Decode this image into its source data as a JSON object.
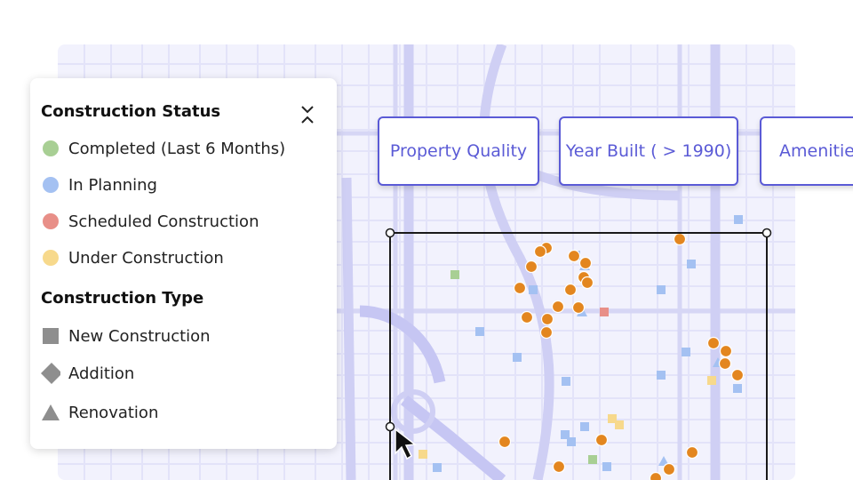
{
  "legend": {
    "status_title": "Construction Status",
    "status_items": [
      {
        "label": "Completed (Last 6 Months)",
        "color": "#a8cf94"
      },
      {
        "label": "In Planning",
        "color": "#a4c1f2"
      },
      {
        "label": "Scheduled Construction",
        "color": "#e88f88"
      },
      {
        "label": "Under Construction",
        "color": "#f7d98c"
      }
    ],
    "type_title": "Construction Type",
    "type_items": [
      {
        "label": "New Construction",
        "shape": "square",
        "color": "#8e8e8e"
      },
      {
        "label": "Addition",
        "shape": "diamond",
        "color": "#8e8e8e"
      },
      {
        "label": "Renovation",
        "shape": "triangle",
        "color": "#8e8e8e"
      }
    ]
  },
  "filters": [
    {
      "label": "Property Quality"
    },
    {
      "label": "Year Built ( > 1990)"
    },
    {
      "label": "Amenities"
    }
  ],
  "map_points": {
    "orange": "#e3861f",
    "blue": "#a4c1f2",
    "yellow": "#f7d98c",
    "green": "#a8cf94",
    "red": "#e88f88"
  },
  "icons": {
    "collapse": "chevrons-collapse-icon",
    "cursor": "mouse-pointer-icon"
  }
}
